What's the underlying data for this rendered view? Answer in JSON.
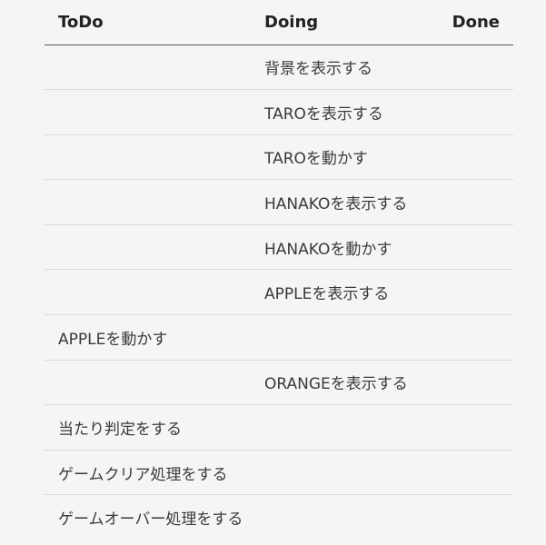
{
  "columns": {
    "todo": "ToDo",
    "doing": "Doing",
    "done": "Done"
  },
  "rows": [
    {
      "todo": "",
      "doing": "背景を表示する",
      "done": ""
    },
    {
      "todo": "",
      "doing": "TAROを表示する",
      "done": ""
    },
    {
      "todo": "",
      "doing": "TAROを動かす",
      "done": ""
    },
    {
      "todo": "",
      "doing": "HANAKOを表示する",
      "done": ""
    },
    {
      "todo": "",
      "doing": "HANAKOを動かす",
      "done": ""
    },
    {
      "todo": "",
      "doing": "APPLEを表示する",
      "done": ""
    },
    {
      "todo": "APPLEを動かす",
      "doing": "",
      "done": ""
    },
    {
      "todo": "",
      "doing": "ORANGEを表示する",
      "done": ""
    },
    {
      "todo": "当たり判定をする",
      "doing": "",
      "done": ""
    },
    {
      "todo": "ゲームクリア処理をする",
      "doing": "",
      "done": ""
    },
    {
      "todo": "ゲームオーバー処理をする",
      "doing": "",
      "done": ""
    }
  ]
}
